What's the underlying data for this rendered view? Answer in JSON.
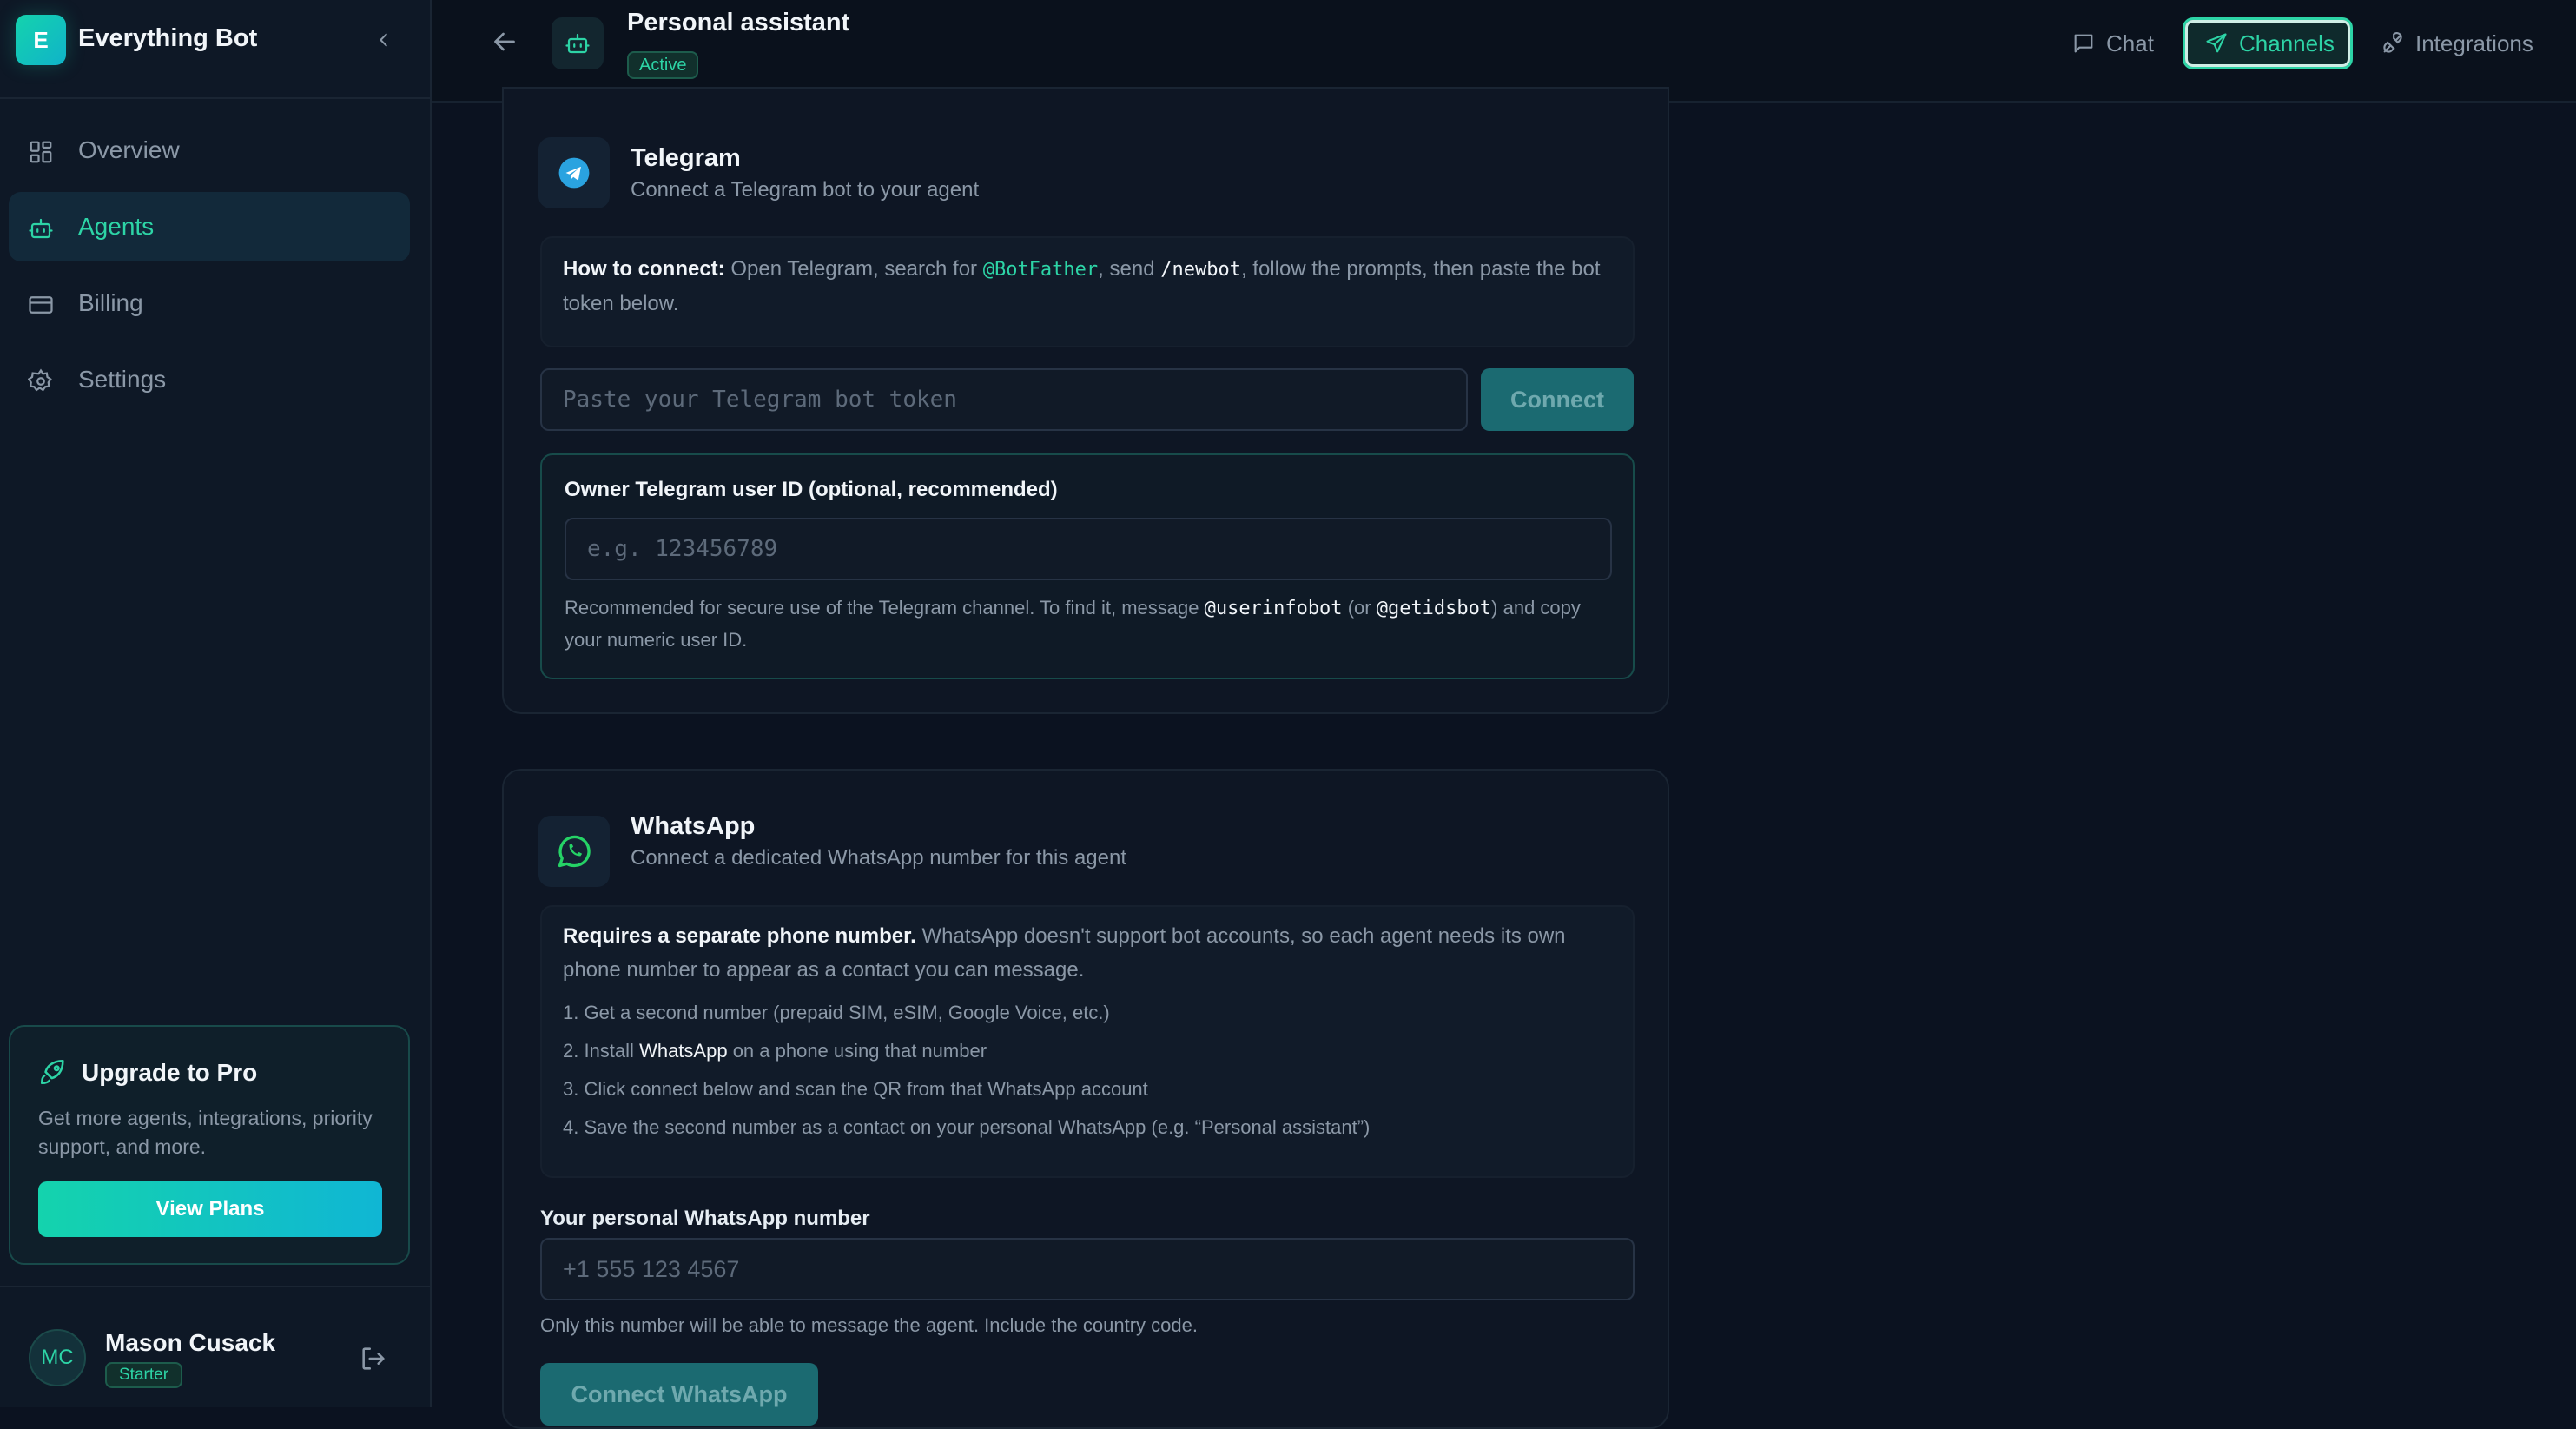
{
  "brand": {
    "logo_letter": "E",
    "name": "Everything Bot"
  },
  "nav": [
    {
      "label": "Overview",
      "icon": "grid-icon"
    },
    {
      "label": "Agents",
      "icon": "bot-icon",
      "active": true
    },
    {
      "label": "Billing",
      "icon": "credit-card-icon"
    },
    {
      "label": "Settings",
      "icon": "gear-icon"
    }
  ],
  "upgrade": {
    "title": "Upgrade to Pro",
    "description": "Get more agents, integrations, priority support, and more.",
    "button": "View Plans"
  },
  "user": {
    "initials": "MC",
    "name": "Mason Cusack",
    "plan": "Starter"
  },
  "header": {
    "title": "Personal assistant",
    "status": "Active",
    "tabs": [
      "Chat",
      "Channels",
      "Integrations"
    ],
    "active_tab": "Channels"
  },
  "telegram": {
    "title": "Telegram",
    "subtitle": "Connect a Telegram bot to your agent",
    "how_label": "How to connect:",
    "how_1": "Open Telegram, search for",
    "how_botfather": "@BotFather",
    "how_2": ", send",
    "how_newbot": "/newbot",
    "how_3": ", follow the prompts, then paste the bot token below.",
    "token_placeholder": "Paste your Telegram bot token",
    "connect": "Connect",
    "owner_label": "Owner Telegram user ID (optional, recommended)",
    "owner_placeholder": "e.g. 123456789",
    "owner_help_1": "Recommended for secure use of the Telegram channel. To find it, message",
    "owner_help_bot1": "@userinfobot",
    "owner_help_2": "(or",
    "owner_help_bot2": "@getidsbot",
    "owner_help_3": ") and copy your numeric user ID."
  },
  "whatsapp": {
    "title": "WhatsApp",
    "subtitle": "Connect a dedicated WhatsApp number for this agent",
    "req_label": "Requires a separate phone number.",
    "req_text": "WhatsApp doesn't support bot accounts, so each agent needs its own phone number to appear as a contact you can message.",
    "step1": "1. Get a second number (prepaid SIM, eSIM, Google Voice, etc.)",
    "step2_a": "2. Install",
    "step2_b": "WhatsApp",
    "step2_c": "on a phone using that number",
    "step3": "3. Click connect below and scan the QR from that WhatsApp account",
    "step4": "4. Save the second number as a contact on your personal WhatsApp (e.g. “Personal assistant”)",
    "number_label": "Your personal WhatsApp number",
    "number_placeholder": "+1 555 123 4567",
    "number_help": "Only this number will be able to message the agent. Include the country code.",
    "connect": "Connect WhatsApp"
  },
  "colors": {
    "accent": "#2dd4a6",
    "background": "#0b1220",
    "sidebar": "#0e1826",
    "telegram": "#2aa3e0",
    "whatsapp": "#25d366"
  }
}
